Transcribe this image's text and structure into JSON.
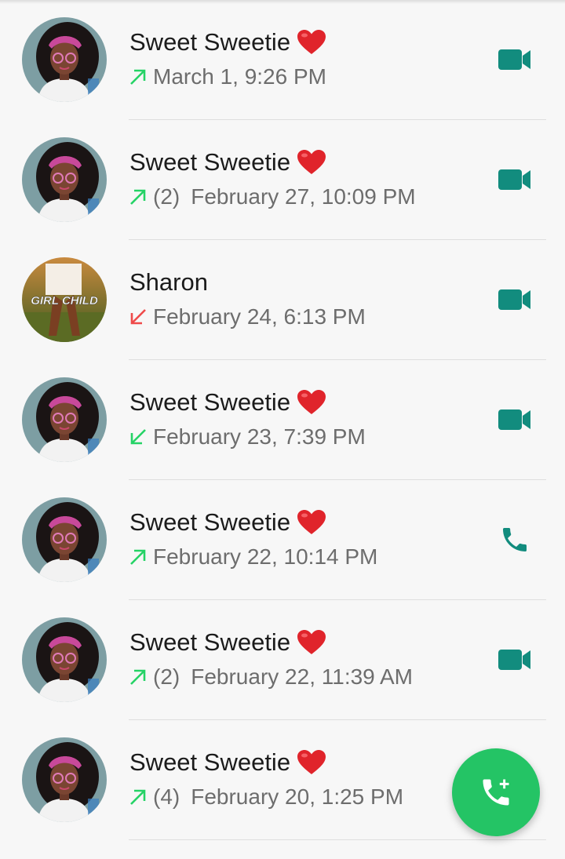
{
  "colors": {
    "accent": "#128c7e",
    "outgoing_arrow": "#25d366",
    "missed_arrow": "#ef4a4a",
    "fab": "#24c465"
  },
  "calls": [
    {
      "name": "Sweet Sweetie",
      "emoji": "red-heart",
      "direction": "outgoing",
      "count": "",
      "time": "March 1, 9:26 PM",
      "type": "video",
      "avatar": "girl-illustration"
    },
    {
      "name": "Sweet Sweetie",
      "emoji": "red-heart",
      "direction": "outgoing",
      "count": "(2)",
      "time": "February 27, 10:09 PM",
      "type": "video",
      "avatar": "girl-illustration"
    },
    {
      "name": "Sharon",
      "emoji": "",
      "direction": "missed",
      "count": "",
      "time": "February 24, 6:13 PM",
      "type": "video",
      "avatar": "girl-child-photo",
      "avatar_text": "GIRL CHILD"
    },
    {
      "name": "Sweet Sweetie",
      "emoji": "red-heart",
      "direction": "incoming",
      "count": "",
      "time": "February 23, 7:39 PM",
      "type": "video",
      "avatar": "girl-illustration"
    },
    {
      "name": "Sweet Sweetie",
      "emoji": "red-heart",
      "direction": "outgoing",
      "count": "",
      "time": "February 22, 10:14 PM",
      "type": "voice",
      "avatar": "girl-illustration"
    },
    {
      "name": "Sweet Sweetie",
      "emoji": "red-heart",
      "direction": "outgoing",
      "count": "(2)",
      "time": "February 22, 11:39 AM",
      "type": "video",
      "avatar": "girl-illustration"
    },
    {
      "name": "Sweet Sweetie",
      "emoji": "red-heart",
      "direction": "outgoing",
      "count": "(4)",
      "time": "February 20, 1:25 PM",
      "type": "video",
      "avatar": "girl-illustration"
    }
  ],
  "fab": {
    "icon": "add-call-icon"
  }
}
